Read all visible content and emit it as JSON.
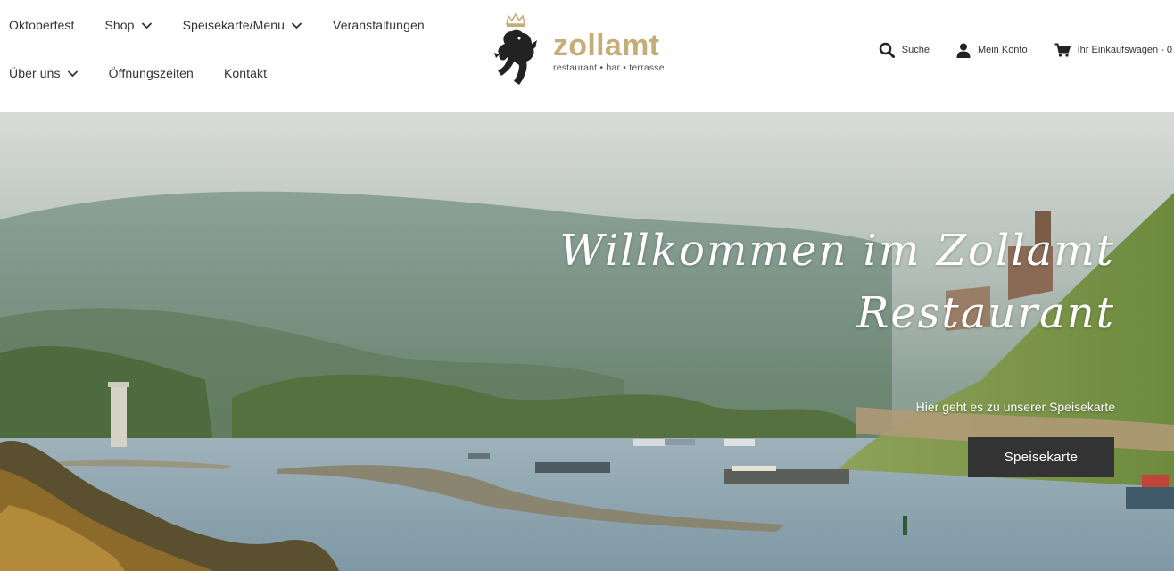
{
  "nav": {
    "row1": [
      {
        "label": "Oktoberfest",
        "dropdown": false
      },
      {
        "label": "Shop",
        "dropdown": true
      },
      {
        "label": "Speisekarte/Menu",
        "dropdown": true
      },
      {
        "label": "Veranstaltungen",
        "dropdown": false
      }
    ],
    "row2": [
      {
        "label": "Über uns",
        "dropdown": true
      },
      {
        "label": "Öffnungszeiten",
        "dropdown": false
      },
      {
        "label": "Kontakt",
        "dropdown": false
      }
    ]
  },
  "logo": {
    "brand": "zollamt",
    "tagline": "restaurant • bar • terrasse",
    "icon": "lion-crest-icon"
  },
  "utility": {
    "search": {
      "label": "Suche",
      "icon": "search-icon"
    },
    "account": {
      "label": "Mein Konto",
      "icon": "user-icon"
    },
    "cart": {
      "label": "Ihr Einkaufswagen - 0",
      "icon": "cart-icon"
    }
  },
  "hero": {
    "title_line1": "Willkommen im Zollamt",
    "title_line2": "Restaurant",
    "subtitle": "Hier geht es zu unserer Speisekarte",
    "button_label": "Speisekarte"
  },
  "colors": {
    "brand_gold": "#c5ad7a",
    "button_bg": "#333333",
    "text": "#333333"
  }
}
